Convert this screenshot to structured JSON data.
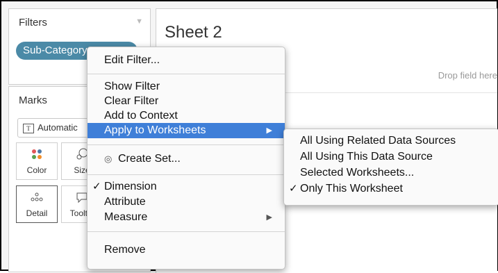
{
  "filters": {
    "title": "Filters",
    "pill_label": "Sub-Category"
  },
  "marks": {
    "title": "Marks",
    "mark_type": "Automatic",
    "buttons": {
      "color": "Color",
      "size": "Size",
      "detail": "Detail",
      "tooltip": "Tooltip"
    }
  },
  "sheet": {
    "title": "Sheet 2",
    "drop_hint": "Drop field here"
  },
  "context_menu": {
    "edit_filter": "Edit Filter...",
    "show_filter": "Show Filter",
    "clear_filter": "Clear Filter",
    "add_to_context": "Add to Context",
    "apply_to_worksheets": "Apply to Worksheets",
    "create_set": "Create Set...",
    "dimension": "Dimension",
    "attribute": "Attribute",
    "measure": "Measure",
    "remove": "Remove",
    "checked": "dimension",
    "highlighted": "apply_to_worksheets"
  },
  "submenu": {
    "items": [
      "All Using Related Data Sources",
      "All Using This Data Source",
      "Selected Worksheets...",
      "Only This Worksheet"
    ],
    "checked": "Only This Worksheet"
  },
  "colors": {
    "pill": "#4b8aa7",
    "highlight": "#3f7fd8"
  }
}
